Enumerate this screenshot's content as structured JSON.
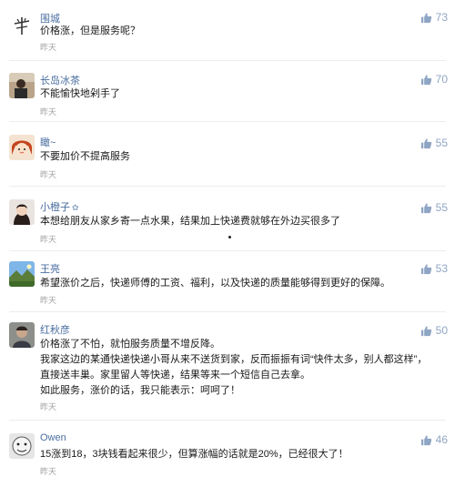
{
  "comments": [
    {
      "username": "围城",
      "text": [
        "价格涨，但是服务呢？"
      ],
      "time": "昨天",
      "likes": "73",
      "avatar_icon": "calligraphy-avatar"
    },
    {
      "username": "长岛冰茶",
      "text": [
        "不能愉快地剁手了"
      ],
      "time": "昨天",
      "likes": "70",
      "avatar_icon": "person-photo-avatar"
    },
    {
      "username": "瞰~",
      "text": [
        "不要加价不提高服务"
      ],
      "time": "昨天",
      "likes": "55",
      "avatar_icon": "cartoon-girl-avatar"
    },
    {
      "username": "小橙子",
      "text": [
        "本想给朋友从家乡寄一点水果，结果加上快递费就够在外边买很多了"
      ],
      "time": "昨天",
      "likes": "55",
      "avatar_icon": "woman-photo-avatar"
    },
    {
      "username": "王亮",
      "text": [
        "希望涨价之后，快递师傅的工资、福利，以及快递的质量能够得到更好的保障。"
      ],
      "time": "昨天",
      "likes": "53",
      "avatar_icon": "landscape-avatar"
    },
    {
      "username": "红秋彦",
      "text": [
        "价格涨了不怕，就怕服务质量不增反降。",
        "我家这边的某通快递快递小哥从来不送货到家，反而振振有词“快件太多，别人都这样”，",
        "直接送丰巢。家里留人等快递，结果等来一个短信自己去拿。",
        "如此服务，涨价的话，我只能表示：呵呵了！"
      ],
      "time": "昨天",
      "likes": "50",
      "avatar_icon": "man-photo-avatar"
    },
    {
      "username": "Owen",
      "text": [
        "15涨到18，3块钱看起来很少，但算涨幅的话就是20%，已经很大了！"
      ],
      "time": "昨天",
      "likes": "46",
      "avatar_icon": "cartoon-face-avatar"
    }
  ]
}
